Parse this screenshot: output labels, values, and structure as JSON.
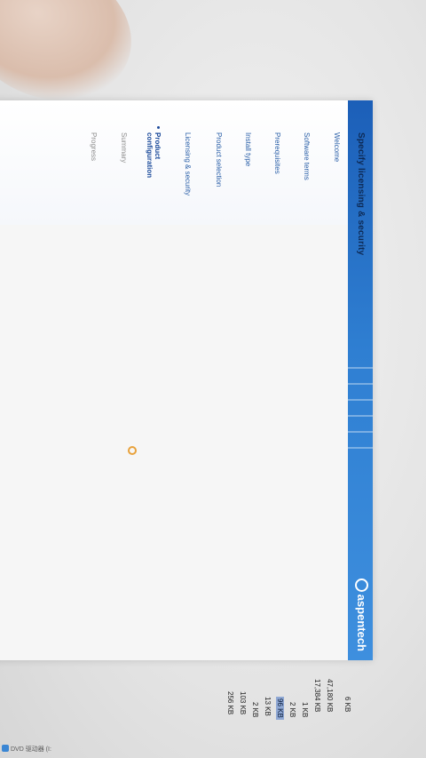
{
  "window": {
    "title": "Specify licensing & security",
    "brand": "aspentech",
    "brand_color": "#2f7fd2"
  },
  "steps": [
    {
      "label": "Welcome",
      "state": "done"
    },
    {
      "label": "Software terms",
      "state": "done"
    },
    {
      "label": "Prerequisites",
      "state": "done"
    },
    {
      "label": "Install type",
      "state": "done"
    },
    {
      "label": "Product selection",
      "state": "done"
    },
    {
      "label": "Licensing & security",
      "state": "done"
    },
    {
      "label": "Product",
      "label2": "configuration",
      "state": "current"
    },
    {
      "label": "Summary",
      "state": "future"
    },
    {
      "label": "Progress",
      "state": "future"
    }
  ],
  "background_files": {
    "sizes": [
      "6 KB",
      "47,180 KB",
      "17,384 KB",
      "1 KB",
      "2 KB",
      "96 KB",
      "13 KB",
      "2 KB",
      "103 KB",
      "256 KB"
    ],
    "selected_index": 5
  },
  "taskbar": {
    "label": "DVD 驱动器 (I:"
  }
}
